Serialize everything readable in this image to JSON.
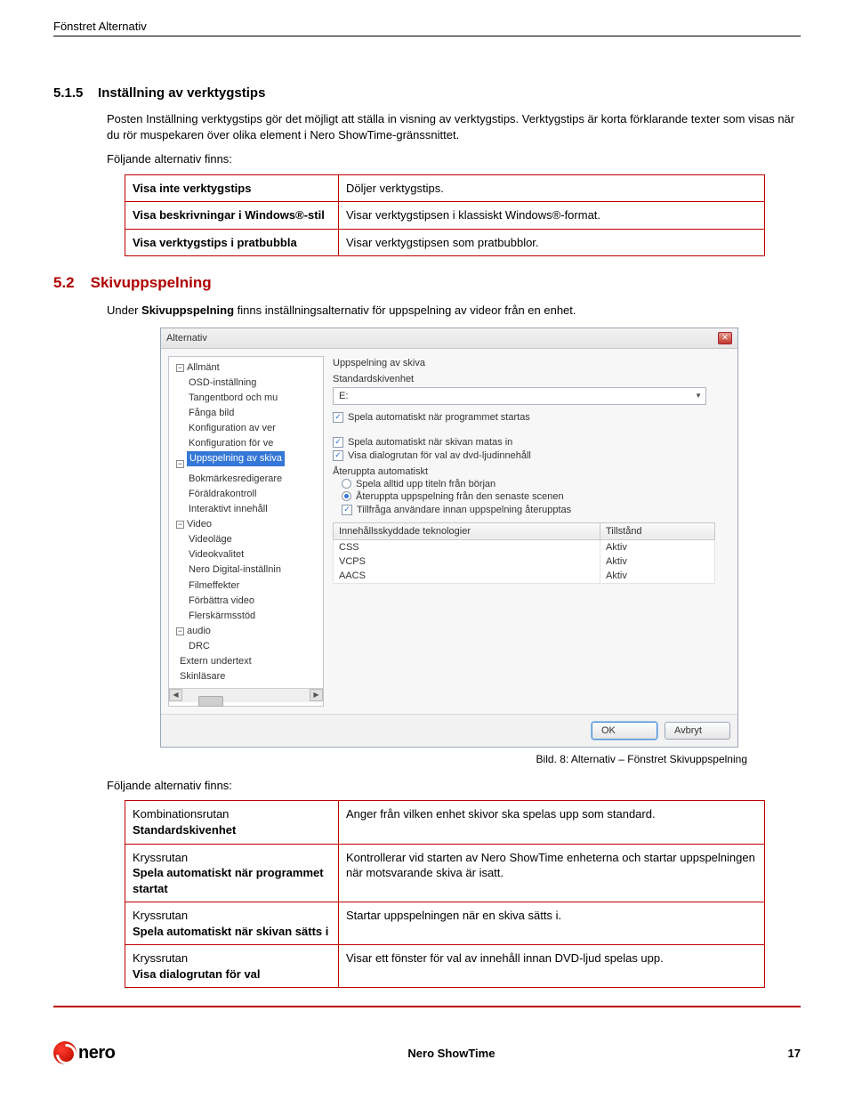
{
  "header": {
    "title": "Fönstret Alternativ"
  },
  "sec515": {
    "num": "5.1.5",
    "title": "Inställning av verktygstips",
    "p1": "Posten Inställning verktygstips gör det möjligt att ställa in visning av verktygstips. Verktygstips är korta förklarande texter som visas när du rör muspekaren över olika element i Nero ShowTime-gränssnittet.",
    "p2": "Följande alternativ finns:",
    "rows": [
      {
        "l": "Visa inte verktygstips",
        "r": "Döljer verktygstips."
      },
      {
        "l": "Visa beskrivningar i Windows®-stil",
        "r": "Visar verktygstipsen i klassiskt Windows®-format."
      },
      {
        "l": "Visa verktygstips i pratbubbla",
        "r": "Visar verktygstipsen som pratbubblor."
      }
    ]
  },
  "sec52": {
    "num": "5.2",
    "title": "Skivuppspelning",
    "p1_pre": "Under ",
    "p1_bold": "Skivuppspelning",
    "p1_post": " finns inställningsalternativ för uppspelning av videor från en enhet."
  },
  "dialog": {
    "title": "Alternativ",
    "tree": {
      "allmant": "Allmänt",
      "items1": [
        "OSD-inställning",
        "Tangentbord och mu",
        "Fånga bild",
        "Konfiguration av ver",
        "Konfiguration för ve"
      ],
      "selected": "Uppspelning av skiva",
      "items2": [
        "Bokmärkesredigerare",
        "Föräldrakontroll",
        "Interaktivt innehåll"
      ],
      "video": "Video",
      "items3": [
        "Videoläge",
        "Videokvalitet",
        "Nero Digital-inställnin",
        "Filmeffekter",
        "Förbättra video",
        "Flerskärmsstöd"
      ],
      "audio": "audio",
      "items4": [
        "DRC"
      ],
      "extern": "Extern undertext",
      "skinlasare": "Skinläsare"
    },
    "right": {
      "title": "Uppspelning av skiva",
      "sub": "Standardskivenhet",
      "drive": "E:",
      "cb1": "Spela automatiskt när programmet startas",
      "cb2": "Spela automatiskt när skivan matas in",
      "cb3": "Visa dialogrutan för val av dvd-ljudinnehåll",
      "grp": "Återuppta automatiskt",
      "r1": "Spela alltid upp titeln från början",
      "r2": "Återuppta uppspelning från den senaste scenen",
      "cb4": "Tillfråga användare innan uppspelning återupptas",
      "th1": "Innehållsskyddade teknologier",
      "th2": "Tillstånd",
      "tech": [
        {
          "n": "CSS",
          "s": "Aktiv"
        },
        {
          "n": "VCPS",
          "s": "Aktiv"
        },
        {
          "n": "AACS",
          "s": "Aktiv"
        }
      ]
    },
    "ok": "OK",
    "cancel": "Avbryt"
  },
  "caption": "Bild. 8: Alternativ – Fönstret Skivuppspelning",
  "sec52b": {
    "lead": "Följande alternativ finns:",
    "rows": [
      {
        "l1": "Kombinationsrutan",
        "l2": "Standardskivenhet",
        "r": "Anger från vilken enhet skivor ska spelas upp som standard."
      },
      {
        "l1": "Kryssrutan",
        "l2": "Spela automatiskt när programmet startat",
        "r": "Kontrollerar vid starten av Nero ShowTime enheterna och startar uppspelningen när motsvarande skiva är isatt."
      },
      {
        "l1": "Kryssrutan",
        "l2": "Spela automatiskt när skivan sätts i",
        "r": "Startar uppspelningen när en skiva sätts i."
      },
      {
        "l1": "Kryssrutan",
        "l2": "Visa dialogrutan för val",
        "r": "Visar ett fönster för val av innehåll innan DVD-ljud spelas upp."
      }
    ]
  },
  "footer": {
    "logo": "nero",
    "center": "Nero ShowTime",
    "page": "17"
  }
}
